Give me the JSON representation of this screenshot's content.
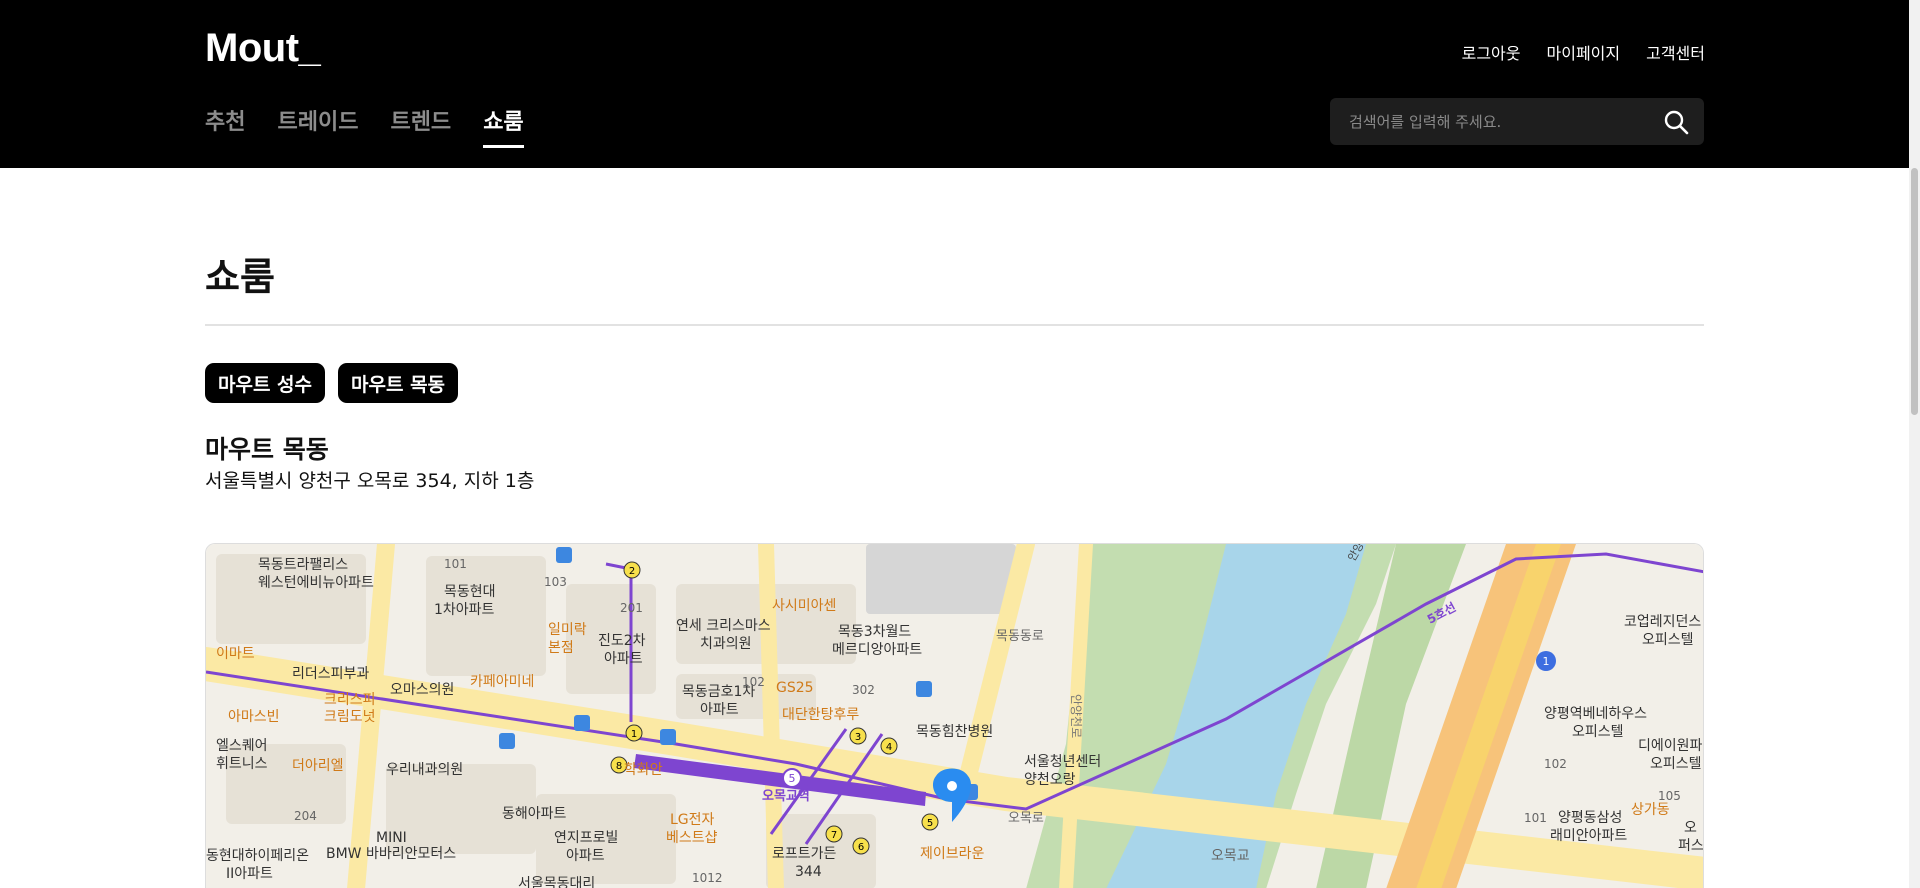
{
  "header": {
    "logo": "Mout_",
    "util_links": [
      "로그아웃",
      "마이페이지",
      "고객센터"
    ],
    "nav_tabs": [
      "추천",
      "트레이드",
      "트렌드",
      "쇼룸"
    ],
    "active_tab": "쇼룸",
    "search": {
      "placeholder": "검색어를 입력해 주세요."
    }
  },
  "page": {
    "title": "쇼룸",
    "store_buttons": [
      "마우트 성수",
      "마우트 목동"
    ],
    "selected_store": {
      "name": "마우트 목동",
      "address": "서울특별시 양천구 오목로 354, 지하 1층"
    }
  },
  "map": {
    "labels": {
      "apt1": "목동트라팰리스",
      "apt1b": "웨스턴에비뉴아파트",
      "hyundai1": "목동현대",
      "hyundai2": "1차아파트",
      "num101": "101",
      "num103": "103",
      "num201": "201",
      "num102": "102",
      "num302": "302",
      "num204": "204",
      "num1012": "1012",
      "jindo1": "진도2차",
      "jindo2": "아파트",
      "ilmirak1": "일미락",
      "ilmirak2": "본점",
      "emart": "이마트",
      "dental1": "연세 크리스마스",
      "dental2": "치과의원",
      "sashimi": "사시미아센",
      "world1": "목동3차월드",
      "world2": "메르디앙아파트",
      "mokdongdongro": "목동동로",
      "leaders": "리더스피부과",
      "omas": "오마스의원",
      "cafeamire": "카페아미네",
      "geumho1": "목동금호1차",
      "geumho2": "아파트",
      "gs25": "GS25",
      "hanuhan": "대단한탕후루",
      "krispy1": "크리스피",
      "krispy2": "크림도넛",
      "amasbin": "아마스빈",
      "elsquare1": "엘스퀘어",
      "elsquare2": "휘트니스",
      "thearie": "더아리엘",
      "woori": "우리내과의원",
      "hakhwan": "학화안",
      "himchan": "목동힘찬병원",
      "youth1": "서울청년센터",
      "youth2": "양천오랑",
      "omokgyo_st": "오목교역",
      "donghae": "동해아파트",
      "yeonji1": "연지프로빌",
      "yeonji2": "아파트",
      "lg1": "LG전자",
      "lg2": "베스트샵",
      "lotte1": "로프트가든",
      "lotte2": "344",
      "jeiburaun": "제이브라운",
      "omokro": "오목로",
      "omokgyo": "오목교",
      "mini": "MINI",
      "bmw": "BMW 바바리안모터스",
      "donghyun1": "동현대하이페리온",
      "donghyun2": "II아파트",
      "seoulmok": "서울목동대리",
      "line5": "5호선",
      "anyangcheon": "안양천로",
      "coupe1": "코업레지던스",
      "coupe2": "오피스텔",
      "yangpyeong1": "양평역베네하우스",
      "yangpyeong2": "오피스텔",
      "diaone1": "디에이원파",
      "diaone2": "오피스텔",
      "samsung1": "양평동삼성",
      "samsung2": "래미안아파트",
      "sanggadong": "상가동",
      "num105": "105",
      "num101b": "101",
      "num102b": "102",
      "anyang_small": "안양",
      "exit1": "1",
      "exit2": "2",
      "exit3": "3",
      "exit4": "4",
      "exit5": "5",
      "exit6": "6",
      "exit7": "7",
      "exit8": "8",
      "line5_badge": "5",
      "line1_badge": "1",
      "o_right": "오",
      "o_right2": "퍼스"
    }
  }
}
